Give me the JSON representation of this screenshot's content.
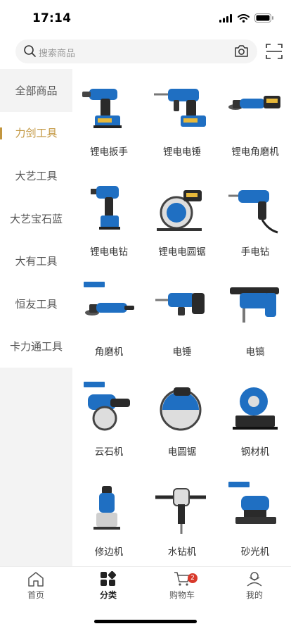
{
  "status_bar": {
    "time": "17:14"
  },
  "search": {
    "placeholder": "搜索商品"
  },
  "sidebar": {
    "items": [
      {
        "label": "全部商品",
        "active": false
      },
      {
        "label": "力剑工具",
        "active": true
      },
      {
        "label": "大艺工具",
        "active": false
      },
      {
        "label": "大艺宝石蓝",
        "active": false
      },
      {
        "label": "大有工具",
        "active": false
      },
      {
        "label": "恒友工具",
        "active": false
      },
      {
        "label": "卡力通工具",
        "active": false
      }
    ]
  },
  "products": [
    {
      "name": "锂电扳手",
      "icon": "impact-wrench-icon"
    },
    {
      "name": "锂电电锤",
      "icon": "rotary-hammer-icon"
    },
    {
      "name": "锂电角磨机",
      "icon": "angle-grinder-icon"
    },
    {
      "name": "锂电电钻",
      "icon": "cordless-drill-icon"
    },
    {
      "name": "锂电电圆锯",
      "icon": "circular-saw-icon"
    },
    {
      "name": "手电钻",
      "icon": "hand-drill-icon"
    },
    {
      "name": "角磨机",
      "icon": "angle-grinder-icon"
    },
    {
      "name": "电锤",
      "icon": "electric-hammer-icon"
    },
    {
      "name": "电镐",
      "icon": "demolition-hammer-icon"
    },
    {
      "name": "云石机",
      "icon": "marble-cutter-icon"
    },
    {
      "name": "电圆锯",
      "icon": "circular-saw-icon"
    },
    {
      "name": "钢材机",
      "icon": "cutoff-machine-icon"
    },
    {
      "name": "修边机",
      "icon": "trimmer-icon"
    },
    {
      "name": "水钻机",
      "icon": "core-drill-icon"
    },
    {
      "name": "砂光机",
      "icon": "sander-icon"
    }
  ],
  "tabbar": {
    "items": [
      {
        "label": "首页",
        "icon": "home-icon",
        "active": false
      },
      {
        "label": "分类",
        "icon": "category-icon",
        "active": true
      },
      {
        "label": "购物车",
        "icon": "cart-icon",
        "active": false,
        "badge": "2"
      },
      {
        "label": "我的",
        "icon": "profile-icon",
        "active": false
      }
    ]
  },
  "colors": {
    "accent": "#c2963f",
    "tool_blue": "#1f6fc2",
    "badge": "#d8392b"
  }
}
